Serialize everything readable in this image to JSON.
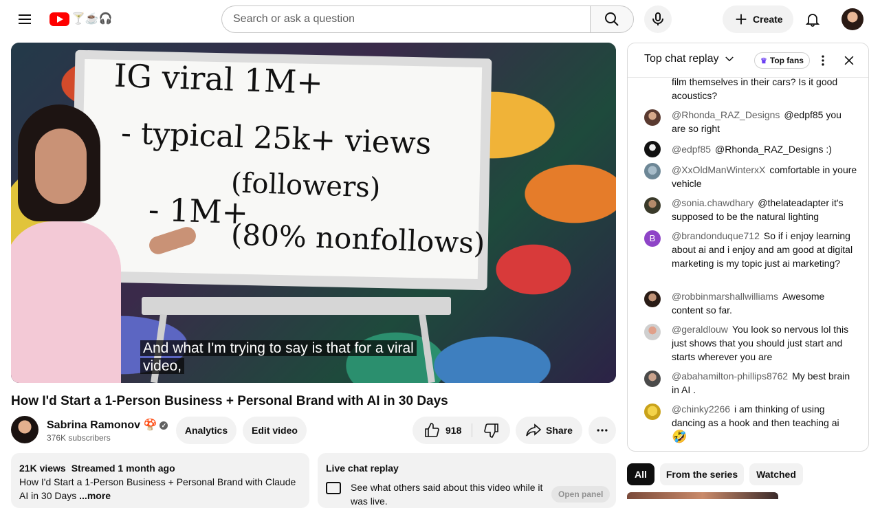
{
  "topbar": {
    "search_placeholder": "Search or ask a question",
    "create_label": "Create",
    "logo_doodle": "🍸☕🎧"
  },
  "player": {
    "board_lines": [
      "IG viral 1M+",
      "- typical 25k+ views",
      "(followers)",
      "- 1M+",
      "(80% nonfollows)"
    ],
    "caption": "And what I'm trying to say is that for a viral video,"
  },
  "video": {
    "title": "How I'd Start a 1-Person Business + Personal Brand with AI in 30 Days",
    "channel_name": "Sabrina Ramonov 🍄",
    "subscribers": "376K subscribers",
    "analytics_label": "Analytics",
    "edit_label": "Edit video",
    "likes": "918",
    "share_label": "Share"
  },
  "description": {
    "views": "21K views",
    "streamed": "Streamed 1 month ago",
    "text": "How I'd Start a 1-Person Business + Personal Brand with Claude AI in 30 Days",
    "more": "...more"
  },
  "live_chat_card": {
    "title": "Live chat replay",
    "text": "See what others said about this video while it was live.",
    "button": "Open panel"
  },
  "chat": {
    "mode": "Top chat replay",
    "top_fans": "Top fans",
    "messages": [
      {
        "author": "",
        "text": "film themselves in their cars? Is it good acoustics?"
      },
      {
        "author": "@Rhonda_RAZ_Designs",
        "text": "@edpf85 you are so right"
      },
      {
        "author": "@edpf85",
        "text": "@Rhonda_RAZ_Designs :)"
      },
      {
        "author": "@XxOldManWinterxX",
        "text": "comfortable in youre vehicle"
      },
      {
        "author": "@sonia.chawdhary",
        "text": "@thelateadapter it's supposed to be the natural lighting"
      },
      {
        "author": "@brandonduque712",
        "text": "So if i enjoy learning about ai and i enjoy and am good at digital marketing is my topic just ai marketing?"
      },
      {
        "author": "@robbinmarshallwilliams",
        "text": "Awesome content so far."
      },
      {
        "author": "@geraldlouw",
        "text": "You look so nervous lol this just shows that you should just start and starts wherever you are"
      },
      {
        "author": "@abahamilton-phillips8762",
        "text": "My best brain in AI ."
      },
      {
        "author": "@chinky2266",
        "text": "i am thinking of using dancing as a hook and then teaching ai",
        "emoji": "🤣"
      }
    ],
    "avatar_initial": "B"
  },
  "chips": {
    "all": "All",
    "series": "From the series",
    "watched": "Watched"
  }
}
